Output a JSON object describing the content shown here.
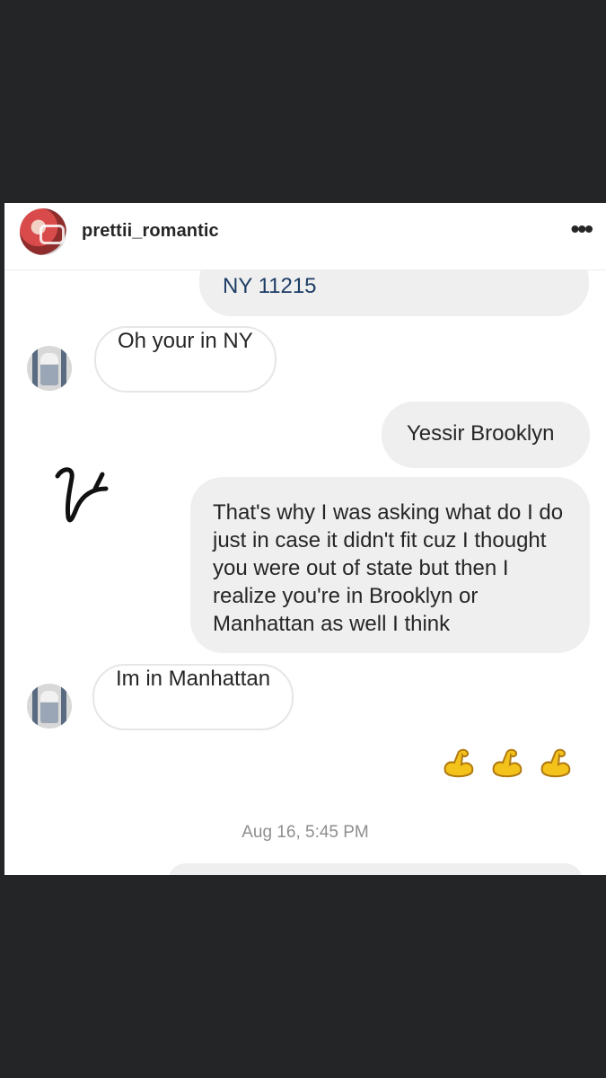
{
  "header": {
    "username": "prettii_romantic",
    "more_icon": "•••"
  },
  "messages": [
    {
      "side": "sent",
      "text": "NY 11215"
    },
    {
      "side": "received",
      "text": "Oh your in NY"
    },
    {
      "side": "sent",
      "text": "Yessir Brooklyn"
    },
    {
      "side": "sent",
      "text": "That's why I was asking what do I do just in case it didn't fit cuz I thought you were out of state but then I realize you're in Brooklyn or Manhattan as well I think"
    },
    {
      "side": "received",
      "text": "Im in Manhattan"
    },
    {
      "side": "sent",
      "emoji": [
        "flexed-biceps",
        "flexed-biceps",
        "flexed-biceps"
      ]
    }
  ],
  "timestamp": "Aug 16, 5:45 PM",
  "colors": {
    "backdrop": "#232526",
    "sent_bubble": "#efefef",
    "received_border": "#e6e6e6",
    "timestamp": "#8e8e8e",
    "emoji": "#f3c21b"
  }
}
